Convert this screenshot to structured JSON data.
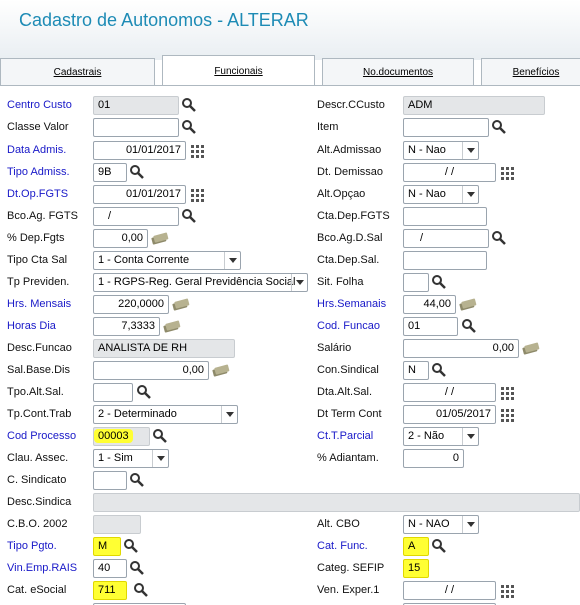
{
  "window": {
    "title": "Cadastro de Autonomos - ALTERAR"
  },
  "tabs": [
    {
      "label": "Cadastrais"
    },
    {
      "label": "Funcionais"
    },
    {
      "label": "No.documentos"
    },
    {
      "label": "Benefícios"
    }
  ],
  "form": {
    "centro_custo": {
      "label": "Centro Custo",
      "value": "01"
    },
    "descr_ccusto": {
      "label": "Descr.CCusto",
      "value": "ADM"
    },
    "classe_valor": {
      "label": "Classe Valor",
      "value": ""
    },
    "item": {
      "label": "Item",
      "value": ""
    },
    "data_admis": {
      "label": "Data Admis.",
      "value": "01/01/2017"
    },
    "alt_admissao": {
      "label": "Alt.Admissao",
      "value": "N - Nao"
    },
    "tipo_admis": {
      "label": "Tipo Admiss.",
      "value": "9B"
    },
    "dt_demissao": {
      "label": "Dt. Demissao",
      "value": "/ /"
    },
    "dt_op_fgts": {
      "label": "Dt.Op.FGTS",
      "value": "01/01/2017"
    },
    "alt_opcao": {
      "label": "Alt.Opçao",
      "value": "N - Nao"
    },
    "bco_ag_fgts": {
      "label": "Bco.Ag. FGTS",
      "value": "/"
    },
    "cta_dep_fgts": {
      "label": "Cta.Dep.FGTS",
      "value": ""
    },
    "pct_dep_fgts": {
      "label": "% Dep.Fgts",
      "value": "0,00"
    },
    "bco_ag_d_sal": {
      "label": "Bco.Ag.D.Sal",
      "value": "/"
    },
    "tipo_cta_sal": {
      "label": "Tipo Cta Sal",
      "value": "1 - Conta Corrente"
    },
    "cta_dep_sal": {
      "label": "Cta.Dep.Sal.",
      "value": ""
    },
    "tp_previden": {
      "label": "Tp Previden.",
      "value": "1 - RGPS-Reg. Geral Previdência Social"
    },
    "sit_folha": {
      "label": "Sit. Folha",
      "value": ""
    },
    "hrs_mensais": {
      "label": "Hrs. Mensais",
      "value": "220,0000"
    },
    "hrs_semanais": {
      "label": "Hrs.Semanais",
      "value": "44,00"
    },
    "horas_dia": {
      "label": "Horas Dia",
      "value": "7,3333"
    },
    "cod_funcao": {
      "label": "Cod. Funcao",
      "value": "01"
    },
    "desc_funcao": {
      "label": "Desc.Funcao",
      "value": "ANALISTA DE RH"
    },
    "salario": {
      "label": "Salário",
      "value": "0,00"
    },
    "sal_base_dis": {
      "label": "Sal.Base.Dis",
      "value": "0,00"
    },
    "con_sindical": {
      "label": "Con.Sindical",
      "value": "N"
    },
    "tpo_alt_sal": {
      "label": "Tpo.Alt.Sal.",
      "value": ""
    },
    "dta_alt_sal": {
      "label": "Dta.Alt.Sal.",
      "value": "/ /"
    },
    "tp_cont_trab": {
      "label": "Tp.Cont.Trab",
      "value": "2 - Determinado"
    },
    "dt_term_cont": {
      "label": "Dt Term Cont",
      "value": "01/05/2017"
    },
    "cod_processo": {
      "label": "Cod Processo",
      "value": "00003"
    },
    "ct_t_parcial": {
      "label": "Ct.T.Parcial",
      "value": "2 - Não"
    },
    "clau_assec": {
      "label": "Clau. Assec.",
      "value": "1 - Sim"
    },
    "pct_adiantam": {
      "label": "% Adiantam.",
      "value": "0"
    },
    "c_sindicato": {
      "label": "C. Sindicato",
      "value": ""
    },
    "desc_sindica": {
      "label": "Desc.Sindica",
      "value": ""
    },
    "cbo_2002": {
      "label": "C.B.O. 2002",
      "value": ""
    },
    "alt_cbo": {
      "label": "Alt. CBO",
      "value": "N - NAO"
    },
    "tipo_pgto": {
      "label": "Tipo Pgto.",
      "value": "M"
    },
    "cat_func": {
      "label": "Cat. Func.",
      "value": "A"
    },
    "vin_emp_rais": {
      "label": "Vin.Emp.RAIS",
      "value": "40"
    },
    "categ_sefip": {
      "label": "Categ. SEFIP",
      "value": "15"
    },
    "cat_esocial": {
      "label": "Cat. eSocial",
      "value": "711"
    },
    "ven_exper_1": {
      "label": "Ven. Exper.1",
      "value": "/ /"
    }
  },
  "colors": {
    "title": "#1d8bb5",
    "required_label": "#1818c8",
    "highlight": "#ffff33"
  },
  "icons": [
    "search-icon",
    "calendar-icon",
    "calculator-icon",
    "dropdown-arrow-icon"
  ]
}
